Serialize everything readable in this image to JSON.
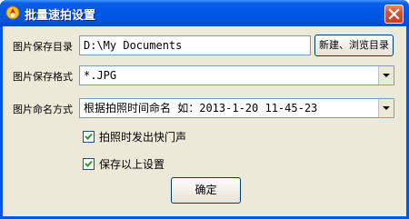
{
  "window": {
    "title": "批量速拍设置",
    "close_icon": "close-icon",
    "app_icon": "camera-app-icon"
  },
  "form": {
    "save_dir_label": "图片保存目录",
    "save_dir_value": "D:\\My Documents",
    "browse_button": "新建、浏览目录",
    "format_label": "图片保存格式",
    "format_value": "*.JPG",
    "naming_label": "图片命名方式",
    "naming_value": "根据拍照时间命名  如：2013-1-20 11-45-23",
    "shutter_sound_label": "拍照时发出快门声",
    "shutter_sound_checked": true,
    "save_settings_label": "保存以上设置",
    "save_settings_checked": true,
    "ok_button": "确定"
  }
}
